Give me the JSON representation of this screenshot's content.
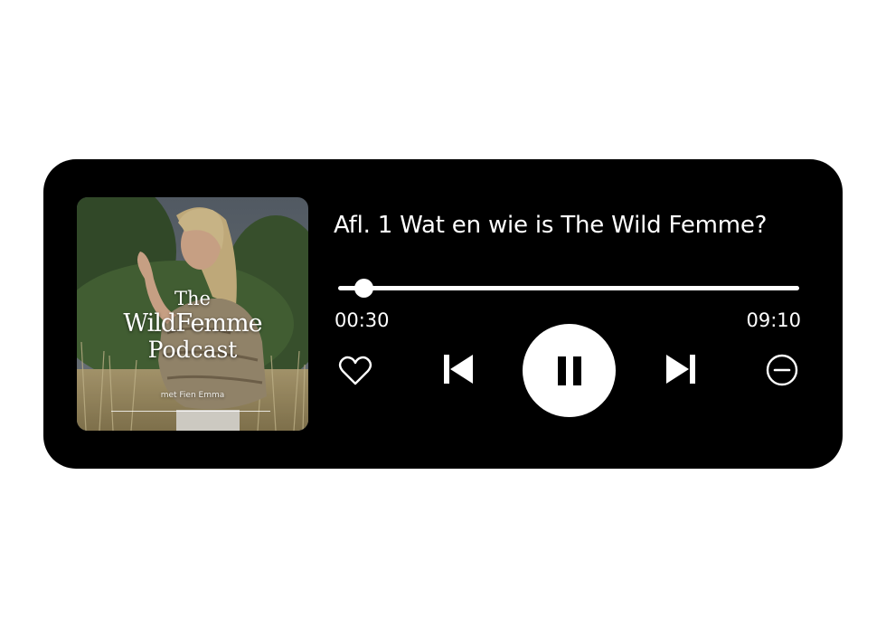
{
  "episode": {
    "title": "Afl. 1 Wat en wie is The Wild Femme?"
  },
  "cover": {
    "title_line1": "The",
    "title_line2": "WildFemme",
    "title_line3": "Podcast",
    "byline": "met Fien Emma"
  },
  "progress": {
    "elapsed": "00:30",
    "total": "09:10",
    "fraction": 0.055
  },
  "controls": {
    "like_icon": "heart-outline-icon",
    "prev_icon": "skip-previous-icon",
    "play_state": "playing",
    "play_icon": "pause-icon",
    "next_icon": "skip-next-icon",
    "remove_icon": "minus-circle-icon"
  },
  "colors": {
    "player_background": "#000000",
    "foreground": "#ffffff"
  }
}
